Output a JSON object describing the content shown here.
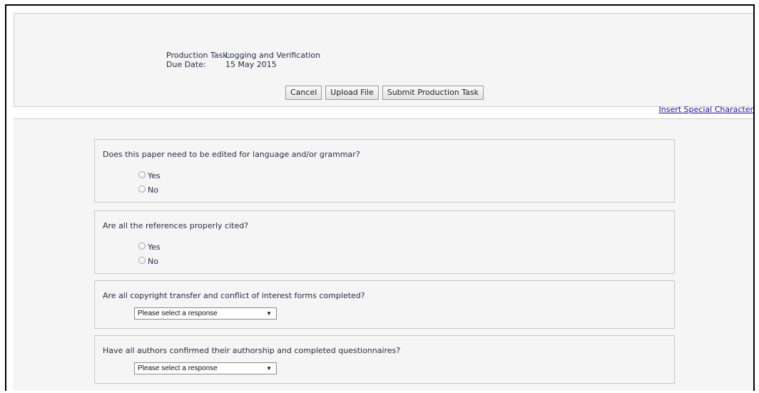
{
  "task": {
    "production_label": "Production Task:",
    "production_value": "Logging and Verification",
    "due_label": "Due Date:",
    "due_value": "15 May 2015"
  },
  "actions": {
    "cancel": "Cancel",
    "upload": "Upload File",
    "submit": "Submit Production Task"
  },
  "insert_special_character": "Insert Special Character",
  "questions": [
    {
      "text": "Does this paper need to be edited for language and/or grammar?",
      "options": [
        "Yes",
        "No"
      ]
    },
    {
      "text": "Are all the references properly cited?",
      "options": [
        "Yes",
        "No"
      ]
    },
    {
      "text": "Are all copyright transfer and conflict of interest forms completed?",
      "select": "Please select a response"
    },
    {
      "text": "Have all authors confirmed their authorship and completed questionnaires?",
      "select": "Please select a response"
    }
  ]
}
